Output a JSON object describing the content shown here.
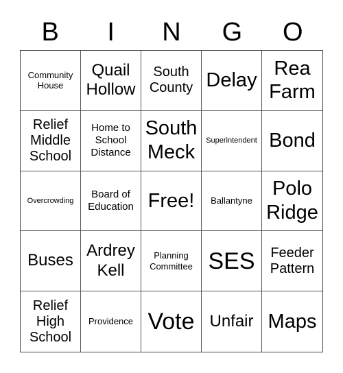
{
  "header": {
    "letters": [
      "B",
      "I",
      "N",
      "G",
      "O"
    ]
  },
  "cells": [
    {
      "text": "Community House",
      "size": "s-sm"
    },
    {
      "text": "Quail Hollow",
      "size": "s-xl"
    },
    {
      "text": "South County",
      "size": "s-lg"
    },
    {
      "text": "Delay",
      "size": "s-xxl"
    },
    {
      "text": "Rea Farm",
      "size": "s-xxl"
    },
    {
      "text": "Relief Middle School",
      "size": "s-lg"
    },
    {
      "text": "Home to School Distance",
      "size": "s-md"
    },
    {
      "text": "South Meck",
      "size": "s-xxl"
    },
    {
      "text": "Superintendent",
      "size": "s-xs"
    },
    {
      "text": "Bond",
      "size": "s-xxl"
    },
    {
      "text": "Overcrowding",
      "size": "s-xs"
    },
    {
      "text": "Board of Education",
      "size": "s-md"
    },
    {
      "text": "Free!",
      "size": "s-xxl"
    },
    {
      "text": "Ballantyne",
      "size": "s-sm"
    },
    {
      "text": "Polo Ridge",
      "size": "s-xxl"
    },
    {
      "text": "Buses",
      "size": "s-xl"
    },
    {
      "text": "Ardrey Kell",
      "size": "s-xl"
    },
    {
      "text": "Planning Committee",
      "size": "s-sm"
    },
    {
      "text": "SES",
      "size": "s-huge"
    },
    {
      "text": "Feeder Pattern",
      "size": "s-lg"
    },
    {
      "text": "Relief High School",
      "size": "s-lg"
    },
    {
      "text": "Providence",
      "size": "s-sm"
    },
    {
      "text": "Vote",
      "size": "s-huge"
    },
    {
      "text": "Unfair",
      "size": "s-xl"
    },
    {
      "text": "Maps",
      "size": "s-xxl"
    }
  ]
}
